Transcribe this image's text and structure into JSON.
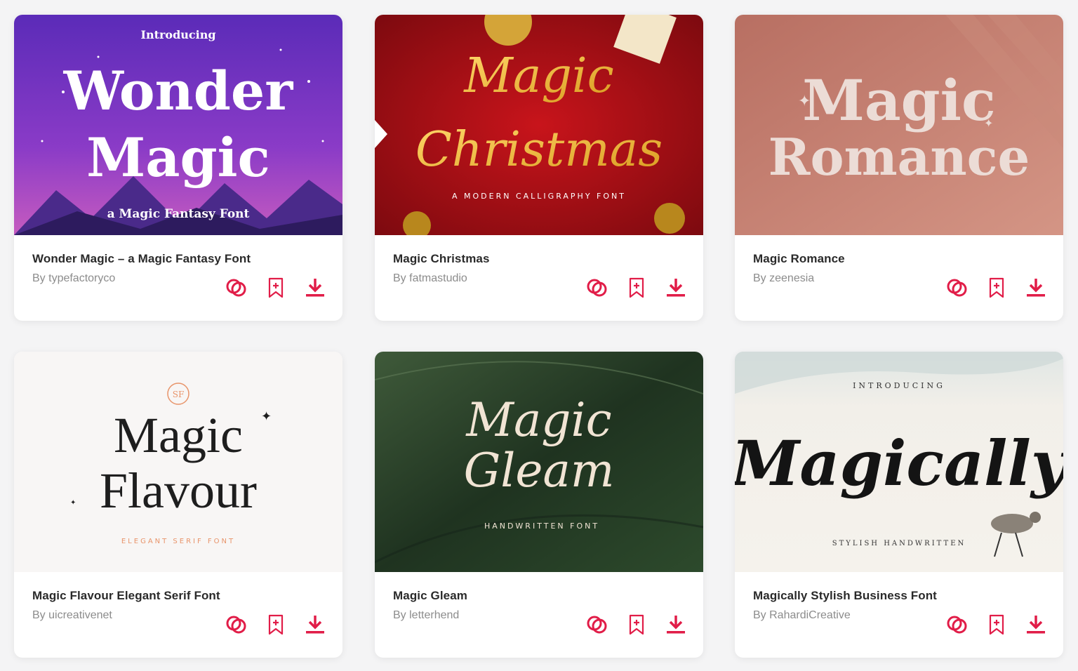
{
  "accent_color": "#e11d48",
  "cards": [
    {
      "title": "Wonder Magic – a Magic Fantasy Font",
      "author": "By typefactoryco",
      "preview": {
        "kicker": "Introducing",
        "line1": "Wonder",
        "line2": "Magic",
        "tagline": "a Magic Fantasy Font"
      }
    },
    {
      "title": "Magic Christmas",
      "author": "By fatmastudio",
      "preview": {
        "line1": "Magic",
        "line2": "Christmas",
        "tagline": "A MODERN CALLIGRAPHY FONT"
      }
    },
    {
      "title": "Magic Romance",
      "author": "By zeenesia",
      "preview": {
        "line1": "Magic",
        "line2": "Romance"
      }
    },
    {
      "title": "Magic Flavour Elegant Serif Font",
      "author": "By uicreativenet",
      "preview": {
        "monogram": "SF",
        "line1": "Magic",
        "line2": "Flavour",
        "tagline": "ELEGANT SERIF FONT"
      }
    },
    {
      "title": "Magic Gleam",
      "author": "By letterhend",
      "preview": {
        "line1": "Magic",
        "line2": "Gleam",
        "tagline": "HANDWRITTEN FONT"
      }
    },
    {
      "title": "Magically Stylish Business Font",
      "author": "By RahardiCreative",
      "preview": {
        "kicker": "INTRODUCING",
        "line1": "Magically",
        "tagline": "STYLISH HANDWRITTEN"
      }
    }
  ],
  "icons": [
    "link-icon",
    "bookmark-add-icon",
    "download-icon"
  ]
}
